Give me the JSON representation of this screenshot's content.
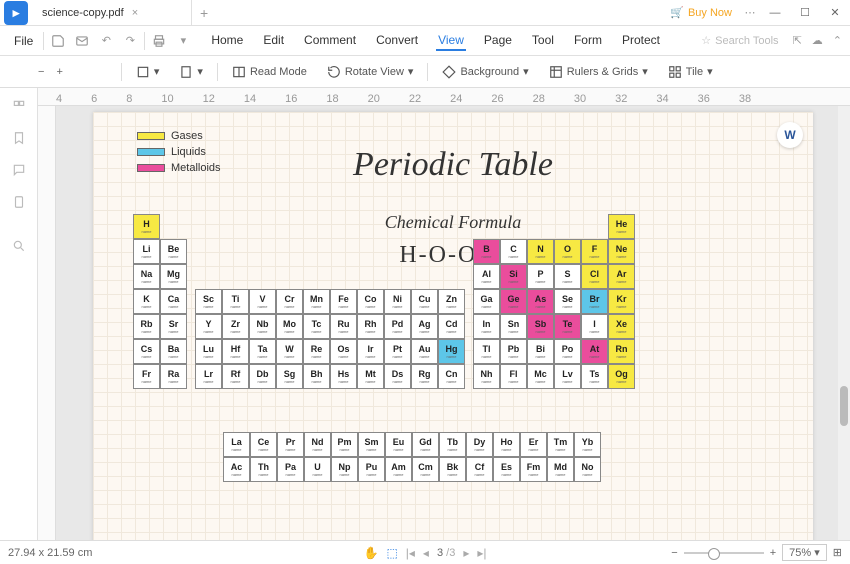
{
  "titlebar": {
    "tab_title": "science-copy.pdf",
    "buy_now": "Buy Now"
  },
  "menubar": {
    "file": "File",
    "items": [
      "Home",
      "Edit",
      "Comment",
      "Convert",
      "View",
      "Page",
      "Tool",
      "Form",
      "Protect"
    ],
    "active_index": 4,
    "search_placeholder": "Search Tools"
  },
  "toolbar": {
    "read_mode": "Read Mode",
    "rotate_view": "Rotate View",
    "background": "Background",
    "rulers_grids": "Rulers & Grids",
    "tile": "Tile"
  },
  "ruler_marks": [
    "4",
    "6",
    "8",
    "10",
    "12",
    "14",
    "16",
    "18",
    "20",
    "22",
    "24",
    "26",
    "28",
    "30",
    "32",
    "34",
    "36",
    "38"
  ],
  "document": {
    "title": "Periodic Table",
    "subtitle": "Chemical Formula",
    "formula": "H-O-O-H",
    "legend": {
      "gases": "Gases",
      "liquids": "Liquids",
      "metalloids": "Metalloids"
    }
  },
  "chart_data": {
    "type": "table",
    "title": "Periodic Table",
    "legend": [
      {
        "label": "Gases",
        "color": "#f7e943"
      },
      {
        "label": "Liquids",
        "color": "#5dc6e8"
      },
      {
        "label": "Metalloids",
        "color": "#ea4d9c"
      }
    ],
    "main_grid": [
      [
        {
          "s": "H",
          "c": "gas"
        },
        null,
        null,
        null,
        null,
        null,
        null,
        null,
        null,
        null,
        null,
        null,
        null,
        null,
        null,
        null,
        null,
        {
          "s": "He",
          "c": "gas"
        }
      ],
      [
        {
          "s": "Li"
        },
        {
          "s": "Be"
        },
        null,
        null,
        null,
        null,
        null,
        null,
        null,
        null,
        null,
        null,
        {
          "s": "B",
          "c": "met"
        },
        {
          "s": "C"
        },
        {
          "s": "N",
          "c": "gas"
        },
        {
          "s": "O",
          "c": "gas"
        },
        {
          "s": "F",
          "c": "gas"
        },
        {
          "s": "Ne",
          "c": "gas"
        }
      ],
      [
        {
          "s": "Na"
        },
        {
          "s": "Mg"
        },
        null,
        null,
        null,
        null,
        null,
        null,
        null,
        null,
        null,
        null,
        {
          "s": "Al"
        },
        {
          "s": "Si",
          "c": "met"
        },
        {
          "s": "P"
        },
        {
          "s": "S"
        },
        {
          "s": "Cl",
          "c": "gas"
        },
        {
          "s": "Ar",
          "c": "gas"
        }
      ],
      [
        {
          "s": "K"
        },
        {
          "s": "Ca"
        },
        {
          "s": "Sc"
        },
        {
          "s": "Ti"
        },
        {
          "s": "V"
        },
        {
          "s": "Cr"
        },
        {
          "s": "Mn"
        },
        {
          "s": "Fe"
        },
        {
          "s": "Co"
        },
        {
          "s": "Ni"
        },
        {
          "s": "Cu"
        },
        {
          "s": "Zn"
        },
        {
          "s": "Ga"
        },
        {
          "s": "Ge",
          "c": "met"
        },
        {
          "s": "As",
          "c": "met"
        },
        {
          "s": "Se"
        },
        {
          "s": "Br",
          "c": "liq"
        },
        {
          "s": "Kr",
          "c": "gas"
        }
      ],
      [
        {
          "s": "Rb"
        },
        {
          "s": "Sr"
        },
        {
          "s": "Y"
        },
        {
          "s": "Zr"
        },
        {
          "s": "Nb"
        },
        {
          "s": "Mo"
        },
        {
          "s": "Tc"
        },
        {
          "s": "Ru"
        },
        {
          "s": "Rh"
        },
        {
          "s": "Pd"
        },
        {
          "s": "Ag"
        },
        {
          "s": "Cd"
        },
        {
          "s": "In"
        },
        {
          "s": "Sn"
        },
        {
          "s": "Sb",
          "c": "met"
        },
        {
          "s": "Te",
          "c": "met"
        },
        {
          "s": "I"
        },
        {
          "s": "Xe",
          "c": "gas"
        }
      ],
      [
        {
          "s": "Cs"
        },
        {
          "s": "Ba"
        },
        {
          "s": "Lu"
        },
        {
          "s": "Hf"
        },
        {
          "s": "Ta"
        },
        {
          "s": "W"
        },
        {
          "s": "Re"
        },
        {
          "s": "Os"
        },
        {
          "s": "Ir"
        },
        {
          "s": "Pt"
        },
        {
          "s": "Au"
        },
        {
          "s": "Hg",
          "c": "liq"
        },
        {
          "s": "Tl"
        },
        {
          "s": "Pb"
        },
        {
          "s": "Bi"
        },
        {
          "s": "Po"
        },
        {
          "s": "At",
          "c": "met"
        },
        {
          "s": "Rn",
          "c": "gas"
        }
      ],
      [
        {
          "s": "Fr"
        },
        {
          "s": "Ra"
        },
        {
          "s": "Lr"
        },
        {
          "s": "Rf"
        },
        {
          "s": "Db"
        },
        {
          "s": "Sg"
        },
        {
          "s": "Bh"
        },
        {
          "s": "Hs"
        },
        {
          "s": "Mt"
        },
        {
          "s": "Ds"
        },
        {
          "s": "Rg"
        },
        {
          "s": "Cn"
        },
        {
          "s": "Nh"
        },
        {
          "s": "Fl"
        },
        {
          "s": "Mc"
        },
        {
          "s": "Lv"
        },
        {
          "s": "Ts"
        },
        {
          "s": "Og",
          "c": "gas"
        }
      ]
    ],
    "lanthanides_actinides": [
      [
        {
          "s": "La"
        },
        {
          "s": "Ce"
        },
        {
          "s": "Pr"
        },
        {
          "s": "Nd"
        },
        {
          "s": "Pm"
        },
        {
          "s": "Sm"
        },
        {
          "s": "Eu"
        },
        {
          "s": "Gd"
        },
        {
          "s": "Tb"
        },
        {
          "s": "Dy"
        },
        {
          "s": "Ho"
        },
        {
          "s": "Er"
        },
        {
          "s": "Tm"
        },
        {
          "s": "Yb"
        }
      ],
      [
        {
          "s": "Ac"
        },
        {
          "s": "Th"
        },
        {
          "s": "Pa"
        },
        {
          "s": "U"
        },
        {
          "s": "Np"
        },
        {
          "s": "Pu"
        },
        {
          "s": "Am"
        },
        {
          "s": "Cm"
        },
        {
          "s": "Bk"
        },
        {
          "s": "Cf"
        },
        {
          "s": "Es"
        },
        {
          "s": "Fm"
        },
        {
          "s": "Md"
        },
        {
          "s": "No"
        }
      ]
    ]
  },
  "statusbar": {
    "dimensions": "27.94 x 21.59 cm",
    "page_current": "3",
    "page_total": "/3",
    "zoom": "75%"
  }
}
